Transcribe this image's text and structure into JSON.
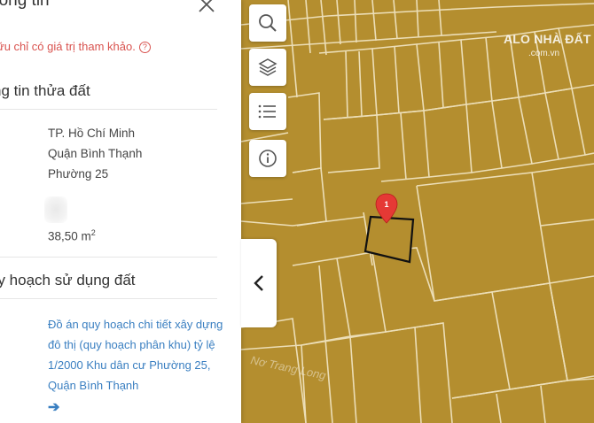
{
  "panel": {
    "title": "hông tin",
    "notice": "ữu chỉ có giá trị tham khảo.",
    "help_glyph": "?",
    "land_section_title": "ng tin thửa đất",
    "city": "TP. Hồ Chí Minh",
    "district": "Quận Bình Thạnh",
    "ward": "Phường 25",
    "area_value": "38,50 m",
    "area_unit_sup": "2",
    "planning_section_title": "uy hoạch sử dụng đất",
    "planning_link": "Đồ án quy hoạch chi tiết xây dựng đô thị (quy hoạch phân khu) tỷ lệ 1/2000 Khu dân cư Phường 25, Quận Bình Thạnh",
    "arrow_glyph": "➔"
  },
  "map": {
    "pin_label": "1",
    "street_label": "Nơ Trang Long",
    "parcel_fill": "#b48e2f",
    "line_color": "#f3e7c6"
  },
  "tools": {
    "icons": [
      "search-icon",
      "layers-icon",
      "list-icon",
      "info-icon"
    ],
    "collapse_glyph": "‹"
  },
  "watermark": {
    "brand": "ALO NHÀ ĐẤT",
    "domain": ".com.vn"
  },
  "colors": {
    "notice_red": "#d9534f",
    "link_blue": "#3a7fc1",
    "pin_red": "#e53935"
  }
}
